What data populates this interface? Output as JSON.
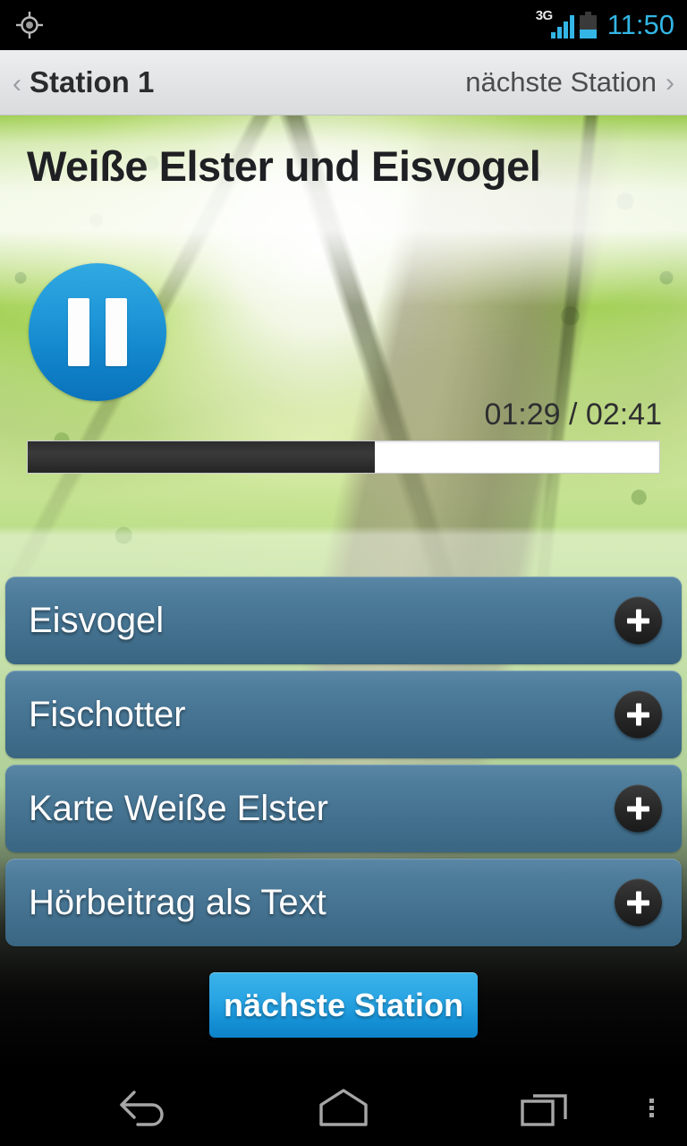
{
  "status_bar": {
    "gps_icon": "location-crosshair-icon",
    "network_label": "3G",
    "signal_icon": "signal-bars-icon",
    "signal_bars": 4,
    "battery_icon": "battery-icon",
    "battery_level_percent": 37,
    "clock": "11:50",
    "accent_color": "#33b5e5"
  },
  "title_bar": {
    "back_chevron": "‹",
    "title": "Station 1",
    "next_label": "nächste Station",
    "next_chevron": "›",
    "background_color": "#e3e5e7"
  },
  "main": {
    "headline": "Weiße Elster und Eisvogel",
    "player": {
      "button_icon": "pause-icon",
      "button_state": "playing",
      "button_color": "#1f97d8",
      "elapsed": "01:29",
      "duration": "02:41",
      "timecode": "01:29 / 02:41",
      "progress_percent": 55
    },
    "links": [
      {
        "label": "Eisvogel",
        "action_icon": "plus-icon"
      },
      {
        "label": "Fischotter",
        "action_icon": "plus-icon"
      },
      {
        "label": "Karte Weiße Elster",
        "action_icon": "plus-icon"
      },
      {
        "label": "Hörbeitrag als Text",
        "action_icon": "plus-icon"
      }
    ],
    "link_row_color": "#4a7a98",
    "cta": {
      "label": "nächste Station",
      "color": "#1590d5"
    }
  },
  "nav_bar": {
    "back_icon": "back-arrow-icon",
    "home_icon": "home-icon",
    "recents_icon": "recent-apps-icon",
    "menu_icon": "overflow-menu-icon"
  }
}
